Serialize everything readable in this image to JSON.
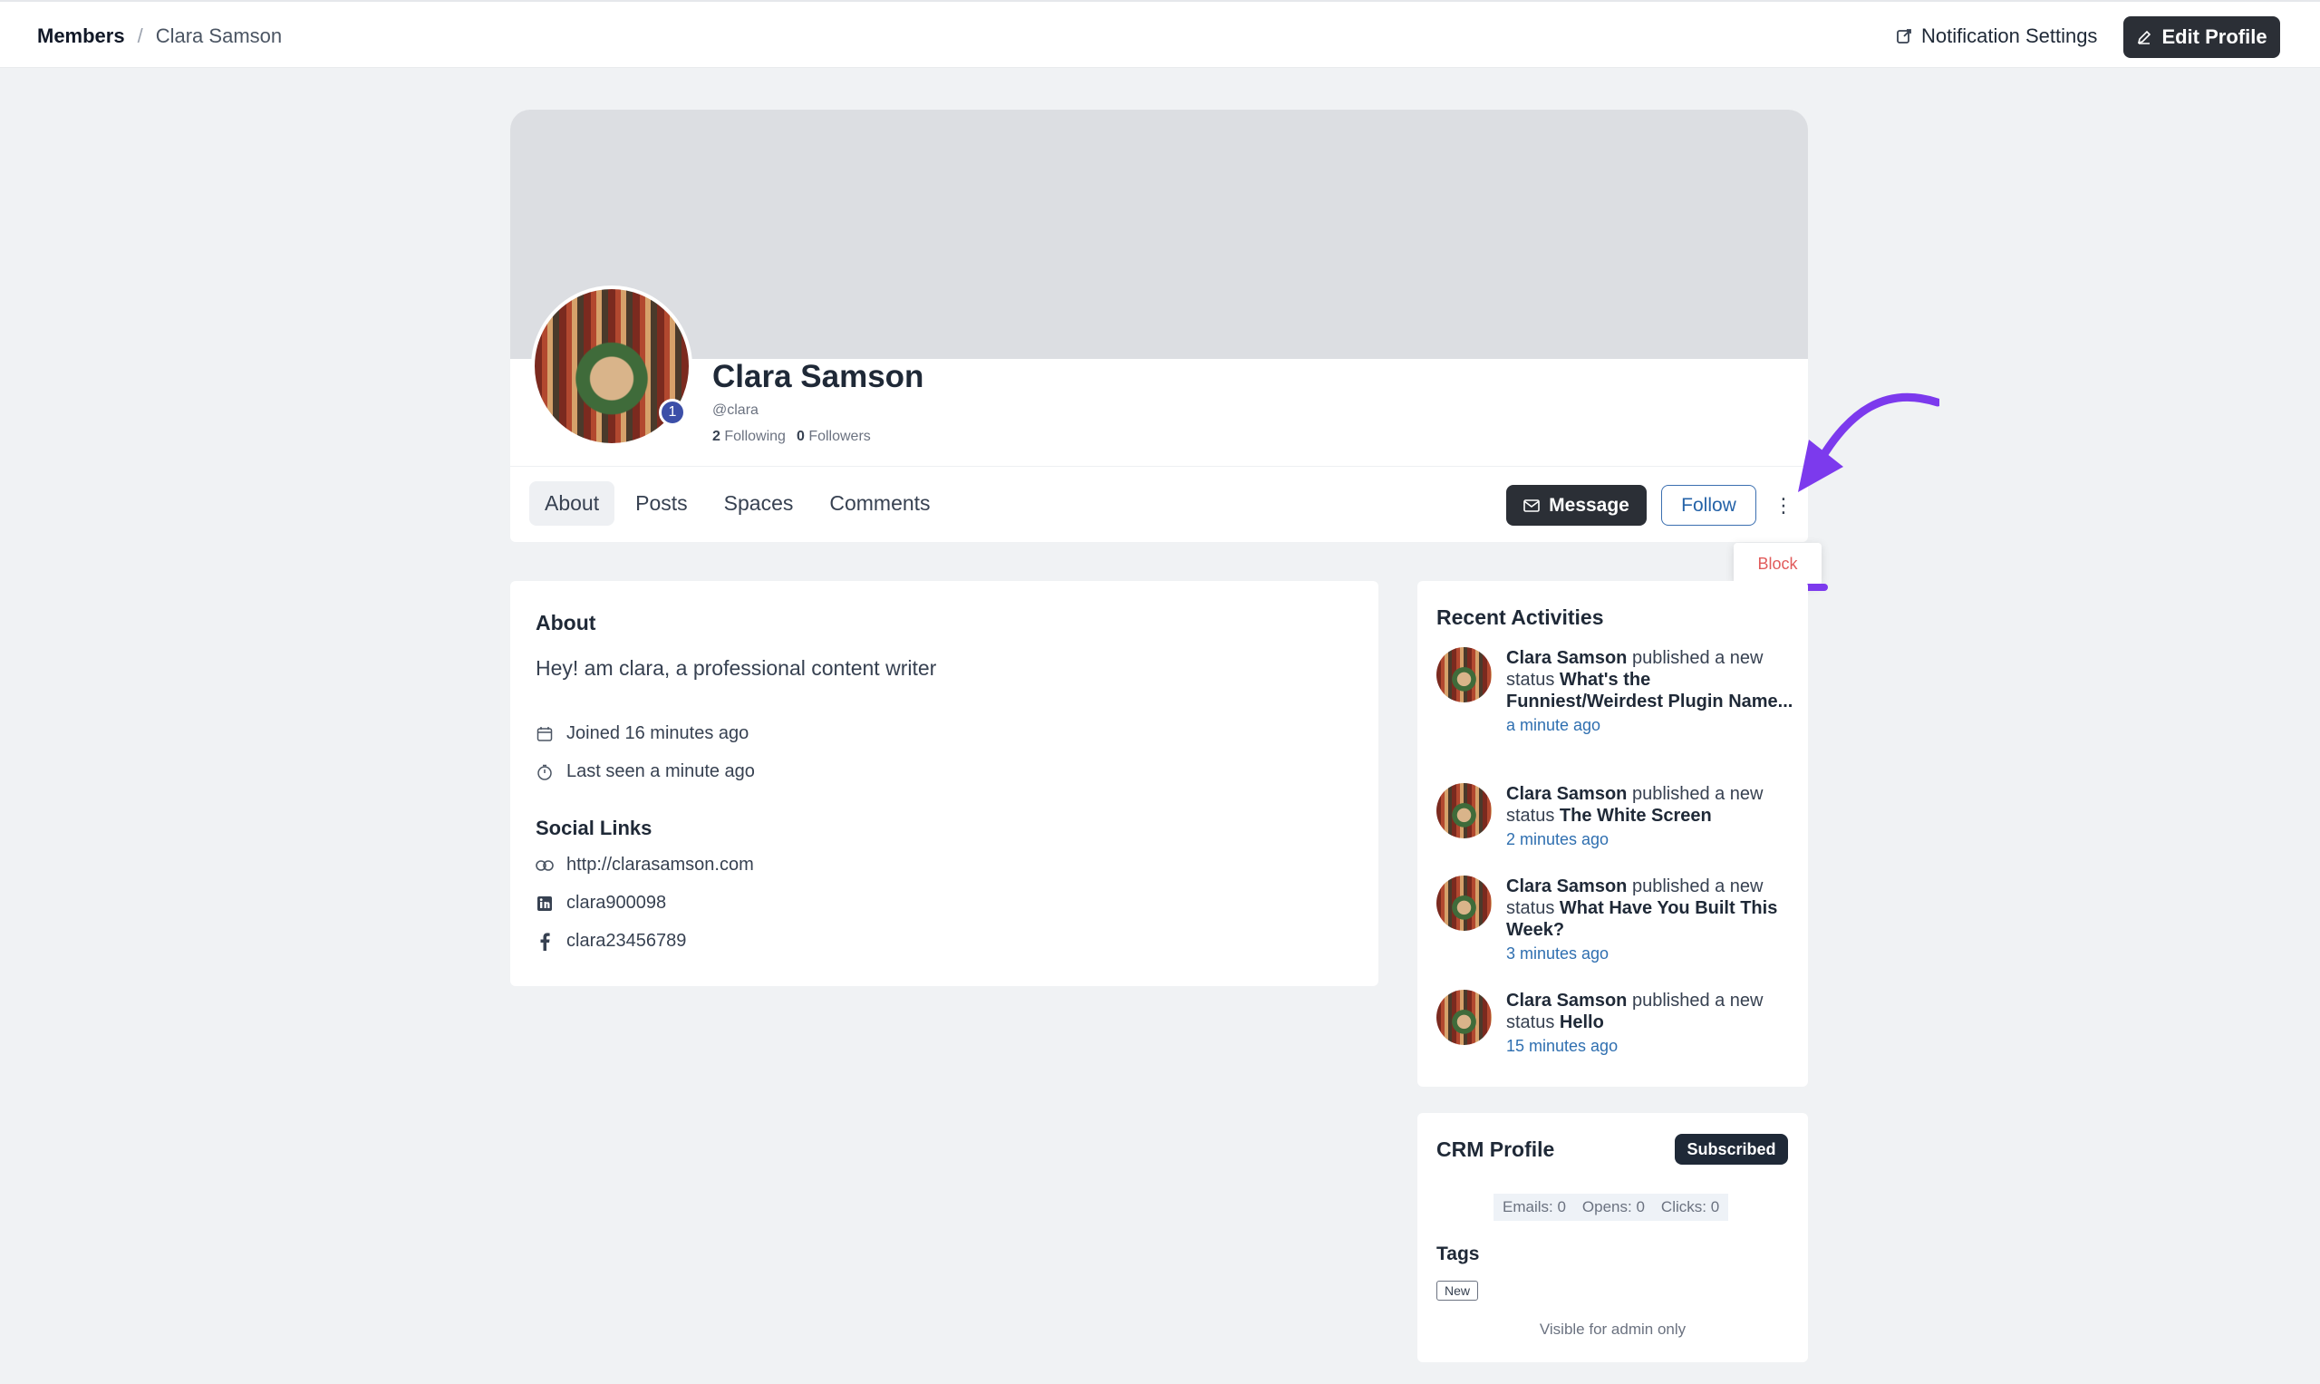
{
  "breadcrumb": {
    "parent": "Members",
    "separator": "/",
    "current": "Clara Samson"
  },
  "header": {
    "notification_settings": "Notification Settings",
    "edit_profile": "Edit Profile"
  },
  "profile": {
    "name": "Clara Samson",
    "handle": "@clara",
    "badge_count": "1",
    "following_count": "2",
    "following_label": "Following",
    "followers_count": "0",
    "followers_label": "Followers"
  },
  "tabs": [
    "About",
    "Posts",
    "Spaces",
    "Comments"
  ],
  "actions": {
    "message": "Message",
    "follow": "Follow",
    "menu_block": "Block"
  },
  "about": {
    "title": "About",
    "bio": "Hey! am clara, a professional content writer",
    "joined": "Joined 16 minutes ago",
    "last_seen": "Last seen a minute ago",
    "social_title": "Social Links",
    "website": "http://clarasamson.com",
    "linkedin": "clara900098",
    "facebook": "clara23456789"
  },
  "recent": {
    "title": "Recent Activities",
    "items": [
      {
        "actor": "Clara Samson",
        "verb": " published a new status ",
        "object": "What's the Funniest/Weirdest Plugin Name...",
        "time": "a minute ago"
      },
      {
        "actor": "Clara Samson",
        "verb": " published a new status ",
        "object": "The White Screen",
        "time": "2 minutes ago"
      },
      {
        "actor": "Clara Samson",
        "verb": " published a new status ",
        "object": "What Have You Built This Week?",
        "time": "3 minutes ago"
      },
      {
        "actor": "Clara Samson",
        "verb": " published a new status ",
        "object": "Hello",
        "time": "15 minutes ago"
      }
    ]
  },
  "crm": {
    "title": "CRM Profile",
    "status": "Subscribed",
    "emails": "Emails: 0",
    "opens": "Opens: 0",
    "clicks": "Clicks: 0",
    "tags_title": "Tags",
    "tag": "New",
    "admin_note": "Visible for admin only"
  },
  "colors": {
    "accent_dark": "#2b2f36",
    "link_blue": "#2f6fb0",
    "annotation_purple": "#7c3aed",
    "danger": "#e15b5b"
  }
}
